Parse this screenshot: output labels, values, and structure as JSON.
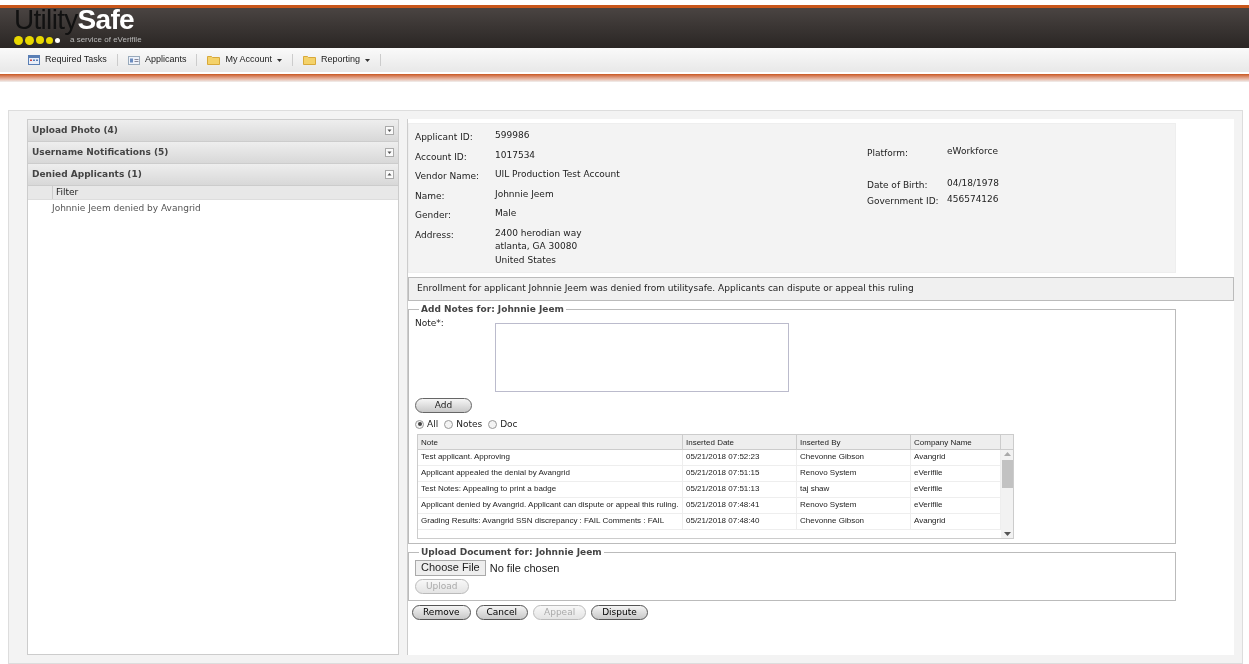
{
  "logo": {
    "part1": "Utility",
    "part2": "Safe",
    "tagline": "a service of eVerifile"
  },
  "nav": [
    {
      "label": "Required Tasks",
      "kind": "calendar",
      "dropdown": false
    },
    {
      "label": "Applicants",
      "kind": "card",
      "dropdown": false
    },
    {
      "label": "My Account",
      "kind": "folder",
      "dropdown": true
    },
    {
      "label": "Reporting",
      "kind": "folder",
      "dropdown": true
    }
  ],
  "sidebar": {
    "sections": [
      {
        "title": "Upload Photo (4)",
        "expanded": false
      },
      {
        "title": "Username Notifications (5)",
        "expanded": false
      },
      {
        "title": "Denied Applicants (1)",
        "expanded": true,
        "filter_header": "Filter",
        "items": [
          "Johnnie Jeem denied by Avangrid"
        ]
      }
    ]
  },
  "details": {
    "left": [
      {
        "label": "Applicant ID:",
        "value": "599986"
      },
      {
        "label": "Account ID:",
        "value": "1017534"
      },
      {
        "label": "Vendor Name:",
        "value": "UIL Production Test Account"
      },
      {
        "label": "Name:",
        "value": "Johnnie Jeem"
      },
      {
        "label": "Gender:",
        "value": "Male"
      },
      {
        "label": "Address:",
        "lines": [
          "2400 herodian way",
          "atlanta, GA 30080",
          "United States"
        ]
      }
    ],
    "right": [
      {
        "label": "Platform:",
        "value": "eWorkforce"
      },
      {
        "label": "Date of Birth:",
        "value": "04/18/1978"
      },
      {
        "label": "Government ID:",
        "value": "456574126"
      }
    ]
  },
  "message": "Enrollment for applicant Johnnie Jeem was denied from utilitysafe. Applicants can dispute or appeal this ruling",
  "notes": {
    "legend": "Add Notes for: Johnnie Jeem",
    "note_label": "Note*:",
    "add_button": "Add",
    "filters": [
      {
        "label": "All",
        "selected": true
      },
      {
        "label": "Notes",
        "selected": false
      },
      {
        "label": "Doc",
        "selected": false
      }
    ],
    "table": {
      "columns": [
        "Note",
        "Inserted Date",
        "Inserted By",
        "Company Name"
      ],
      "rows": [
        [
          "Test applicant. Approving",
          "05/21/2018 07:52:23",
          "Chevonne Gibson",
          "Avangrid"
        ],
        [
          "Applicant appealed the denial by Avangrid",
          "05/21/2018 07:51:15",
          "Renovo System",
          "eVerifile"
        ],
        [
          "Test Notes: Appealing to print a badge",
          "05/21/2018 07:51:13",
          "taj shaw",
          "eVerifile"
        ],
        [
          "Applicant denied by Avangrid. Applicant can dispute or appeal this ruling.",
          "05/21/2018 07:48:41",
          "Renovo System",
          "eVerifile"
        ],
        [
          "Grading Results: Avangrid SSN discrepancy : FAIL Comments : FAIL",
          "05/21/2018 07:48:40",
          "Chevonne Gibson",
          "Avangrid"
        ]
      ]
    }
  },
  "upload": {
    "legend": "Upload Document for: Johnnie Jeem",
    "choose_button": "Choose File",
    "file_status": "No file chosen",
    "upload_button": "Upload",
    "upload_disabled": true
  },
  "actions": [
    {
      "label": "Remove",
      "disabled": false
    },
    {
      "label": "Cancel",
      "disabled": false
    },
    {
      "label": "Appeal",
      "disabled": true
    },
    {
      "label": "Dispute",
      "disabled": false
    }
  ]
}
